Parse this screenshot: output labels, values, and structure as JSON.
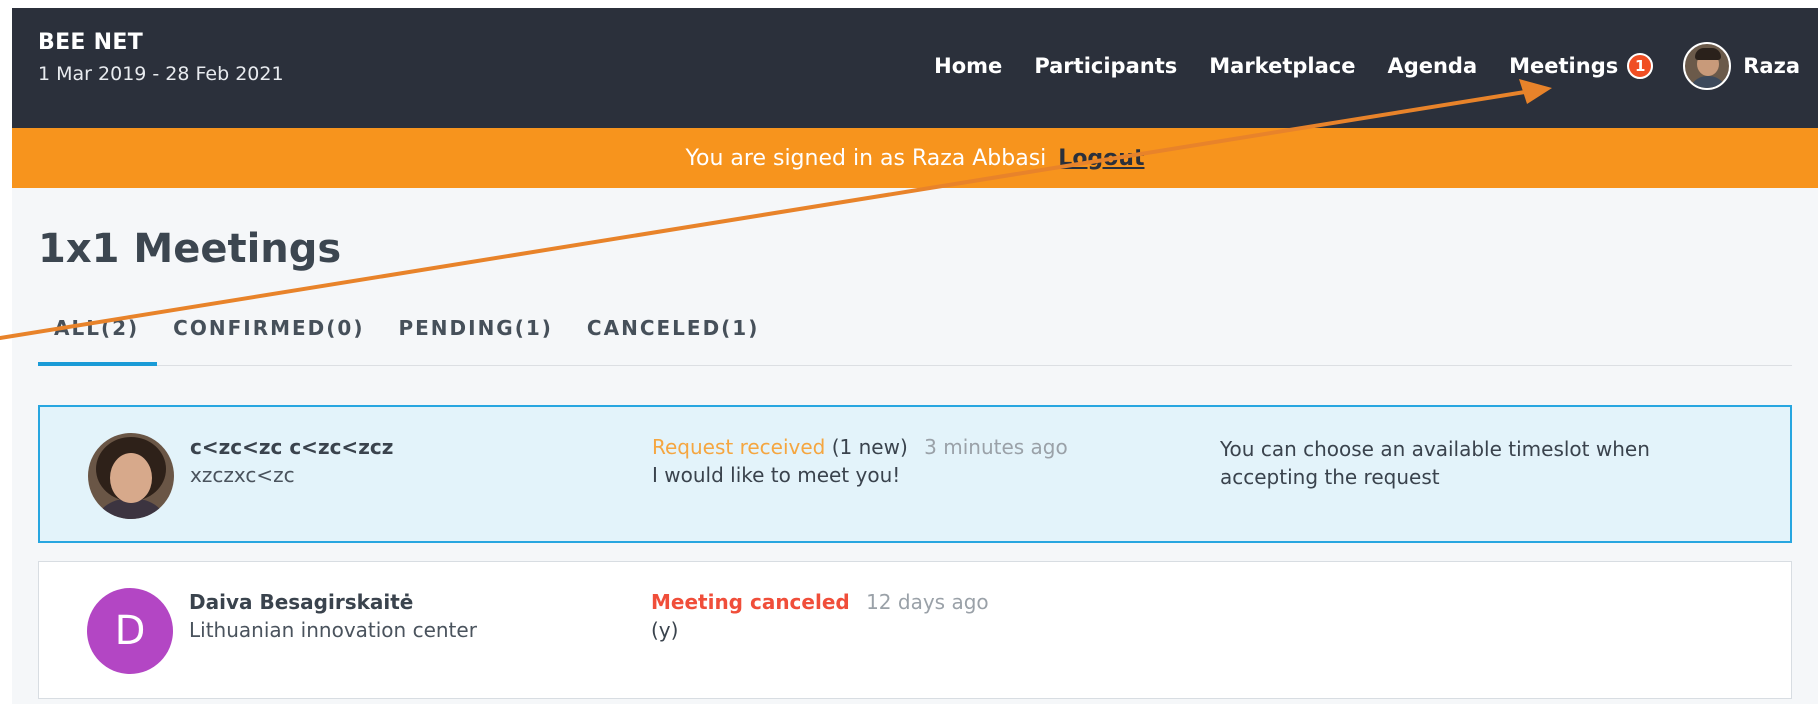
{
  "header": {
    "brand": "BEE NET",
    "dates": "1 Mar 2019 - 28 Feb 2021",
    "nav": [
      {
        "label": "Home"
      },
      {
        "label": "Participants"
      },
      {
        "label": "Marketplace"
      },
      {
        "label": "Agenda"
      },
      {
        "label": "Meetings",
        "badge": "1"
      }
    ],
    "user": "Raza"
  },
  "banner": {
    "text": "You are signed in as Raza Abbasi",
    "logout": "Logout"
  },
  "page": {
    "title": "1x1 Meetings",
    "tabs": [
      {
        "label": "ALL(2)",
        "active": true
      },
      {
        "label": "CONFIRMED(0)"
      },
      {
        "label": "PENDING(1)"
      },
      {
        "label": "CANCELED(1)"
      }
    ]
  },
  "meetings": [
    {
      "name": "c<zc<zc c<zc<zcz",
      "org": "xzczxc<zc",
      "status": "Request received",
      "new_count": "(1 new)",
      "time": "3 minutes ago",
      "message": "I would like to meet you!",
      "note": "You can choose an available timeslot when accepting the request"
    },
    {
      "name": "Daiva Besagirskaitė",
      "org": "Lithuanian innovation center",
      "initial": "D",
      "status": "Meeting canceled",
      "time": "12 days ago",
      "message": "(y)"
    }
  ],
  "colors": {
    "topbar": "#2b303b",
    "banner": "#f7941d",
    "accent": "#1a9bd7",
    "annotation_arrow": "#e8832a"
  }
}
